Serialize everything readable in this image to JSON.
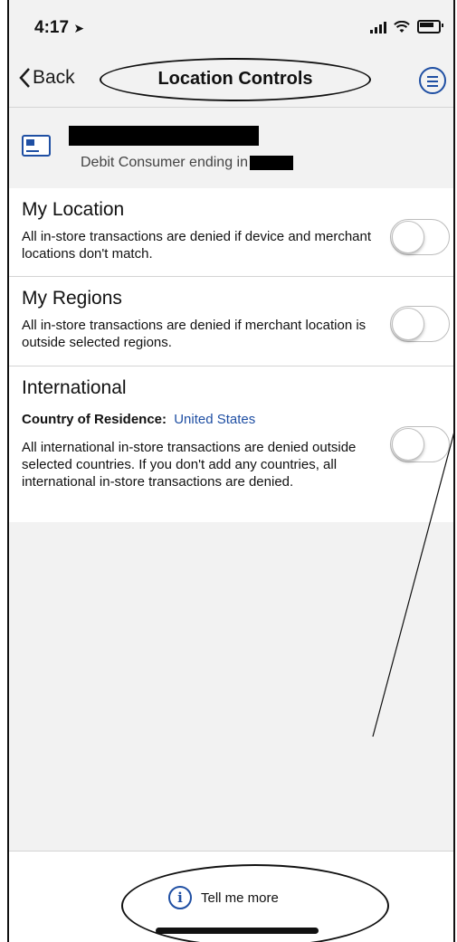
{
  "status_bar": {
    "time": "4:17",
    "icons": [
      "location-arrow-icon",
      "signal-icon",
      "wifi-icon",
      "battery-icon"
    ]
  },
  "nav": {
    "back_label": "Back",
    "title": "Location Controls",
    "menu_icon": "menu-icon"
  },
  "card": {
    "icon": "card-icon",
    "subtitle": "Debit Consumer ending in"
  },
  "sections": {
    "my_location": {
      "title": "My Location",
      "description": "All in-store transactions are denied if device and merchant locations don't match.",
      "toggle_on": false
    },
    "my_regions": {
      "title": "My Regions",
      "description": "All in-store transactions are denied if merchant location is outside selected regions.",
      "toggle_on": false
    },
    "international": {
      "title": "International",
      "country_label": "Country of Residence:",
      "country_value": "United States",
      "description": "All international in-store transactions are denied outside selected countries. If you don't add any countries, all international in-store transactions are denied.",
      "toggle_on": false
    }
  },
  "footer": {
    "info_icon": "info-icon",
    "tell_more_label": "Tell me more"
  },
  "colors": {
    "accent": "#1f4fa3",
    "background": "#f2f2f2",
    "section_bg": "#ffffff"
  }
}
